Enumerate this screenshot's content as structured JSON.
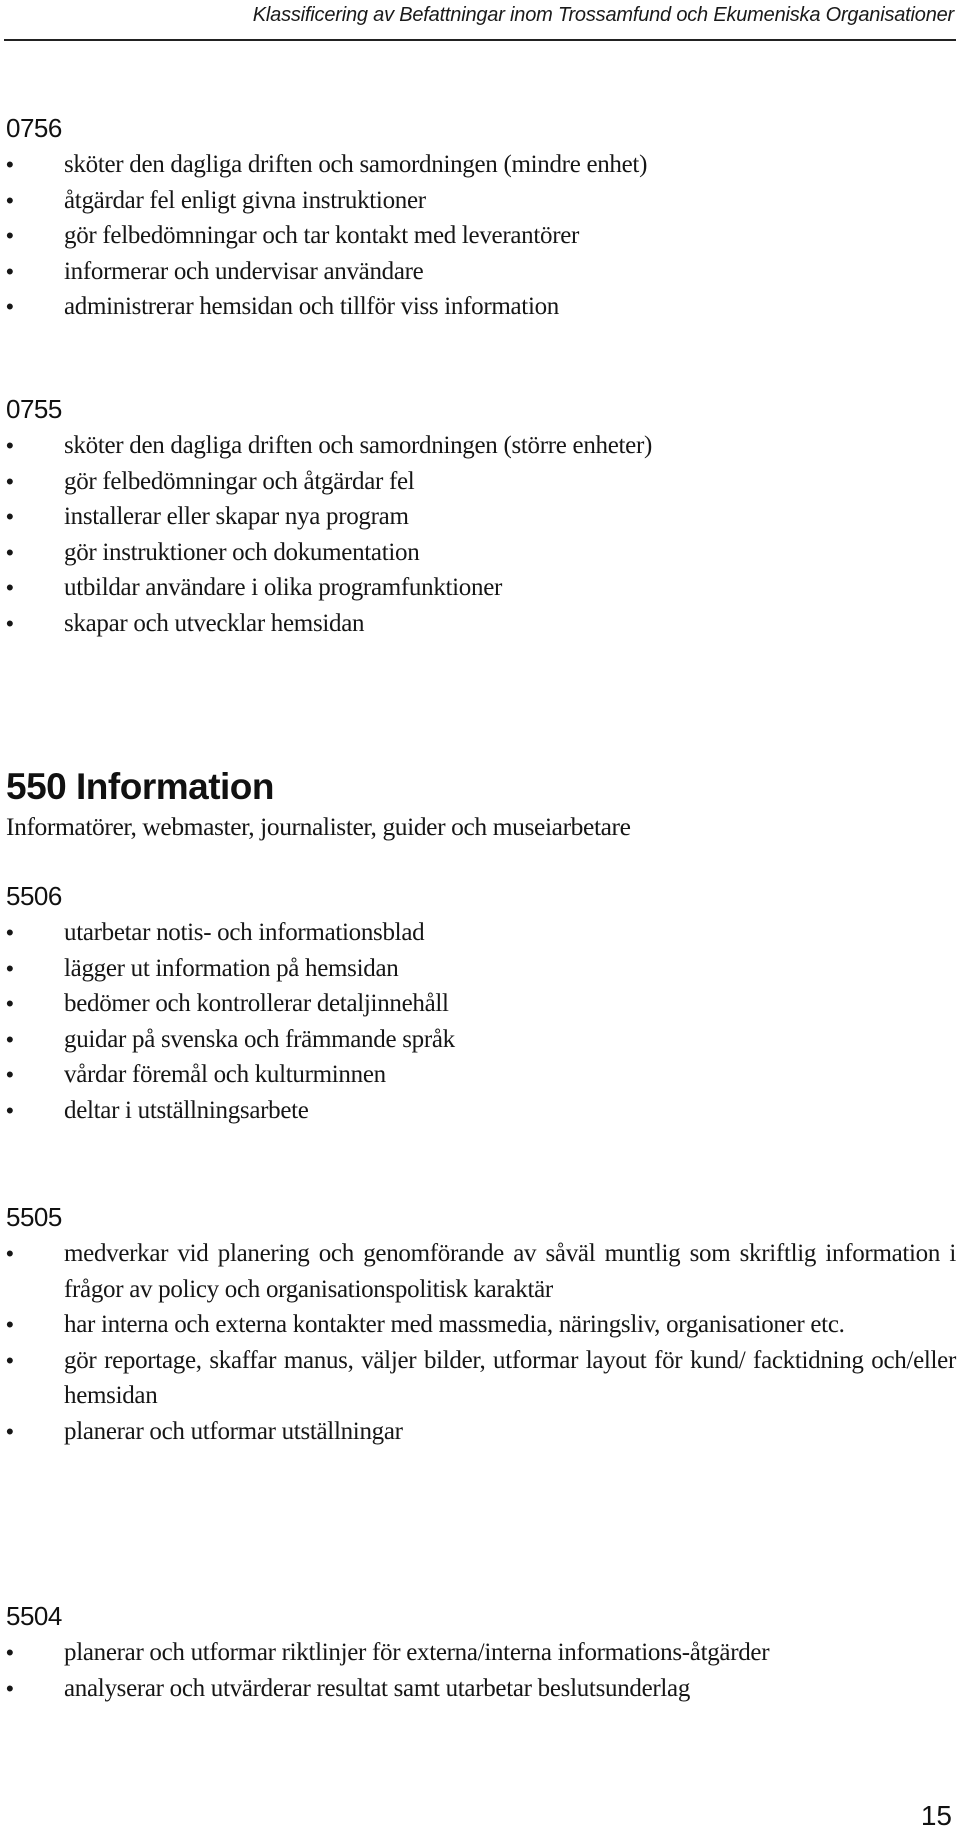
{
  "header": {
    "running_title": "Klassificering av Befattningar inom Trossamfund och Ekumeniska Organisationer"
  },
  "sections": [
    {
      "code": "0756",
      "items": [
        "sköter den dagliga driften och samordningen (mindre enhet)",
        "åtgärdar fel enligt givna instruktioner",
        "gör felbedömningar och tar kontakt med leverantörer",
        "informerar och undervisar användare",
        "administrerar hemsidan och tillför viss information"
      ]
    },
    {
      "code": "0755",
      "items": [
        "sköter den dagliga driften och samordningen (större enheter)",
        "gör felbedömningar och åtgärdar fel",
        "installerar eller skapar nya program",
        "gör instruktioner och dokumentation",
        "utbildar användare i olika programfunktioner",
        "skapar och utvecklar hemsidan"
      ]
    }
  ],
  "group": {
    "title": "550 Information",
    "subtitle": "Informatörer, webmaster, journalister, guider och museiarbetare",
    "sections": [
      {
        "code": "5506",
        "items": [
          "utarbetar notis- och informationsblad",
          "lägger ut information på hemsidan",
          "bedömer och kontrollerar detaljinnehåll",
          "guidar på svenska och främmande språk",
          "vårdar föremål och kulturminnen",
          "deltar i utställningsarbete"
        ]
      },
      {
        "code": "5505",
        "items": [
          "medverkar vid planering och genomförande av såväl muntlig som skriftlig information i frågor av policy och organisationspolitisk karaktär",
          "har interna och externa kontakter med massmedia, näringsliv, organisationer etc.",
          "gör reportage, skaffar manus, väljer bilder, utformar layout för kund/ facktidning och/eller hemsidan",
          "planerar och utformar utställningar"
        ]
      },
      {
        "code": "5504",
        "items": [
          "planerar och utformar riktlinjer för externa/interna informations-åtgärder",
          "analyserar och utvärderar resultat samt utarbetar beslutsunderlag"
        ]
      }
    ]
  },
  "bullet_glyph": "•",
  "footer": {
    "page_number": "15"
  }
}
